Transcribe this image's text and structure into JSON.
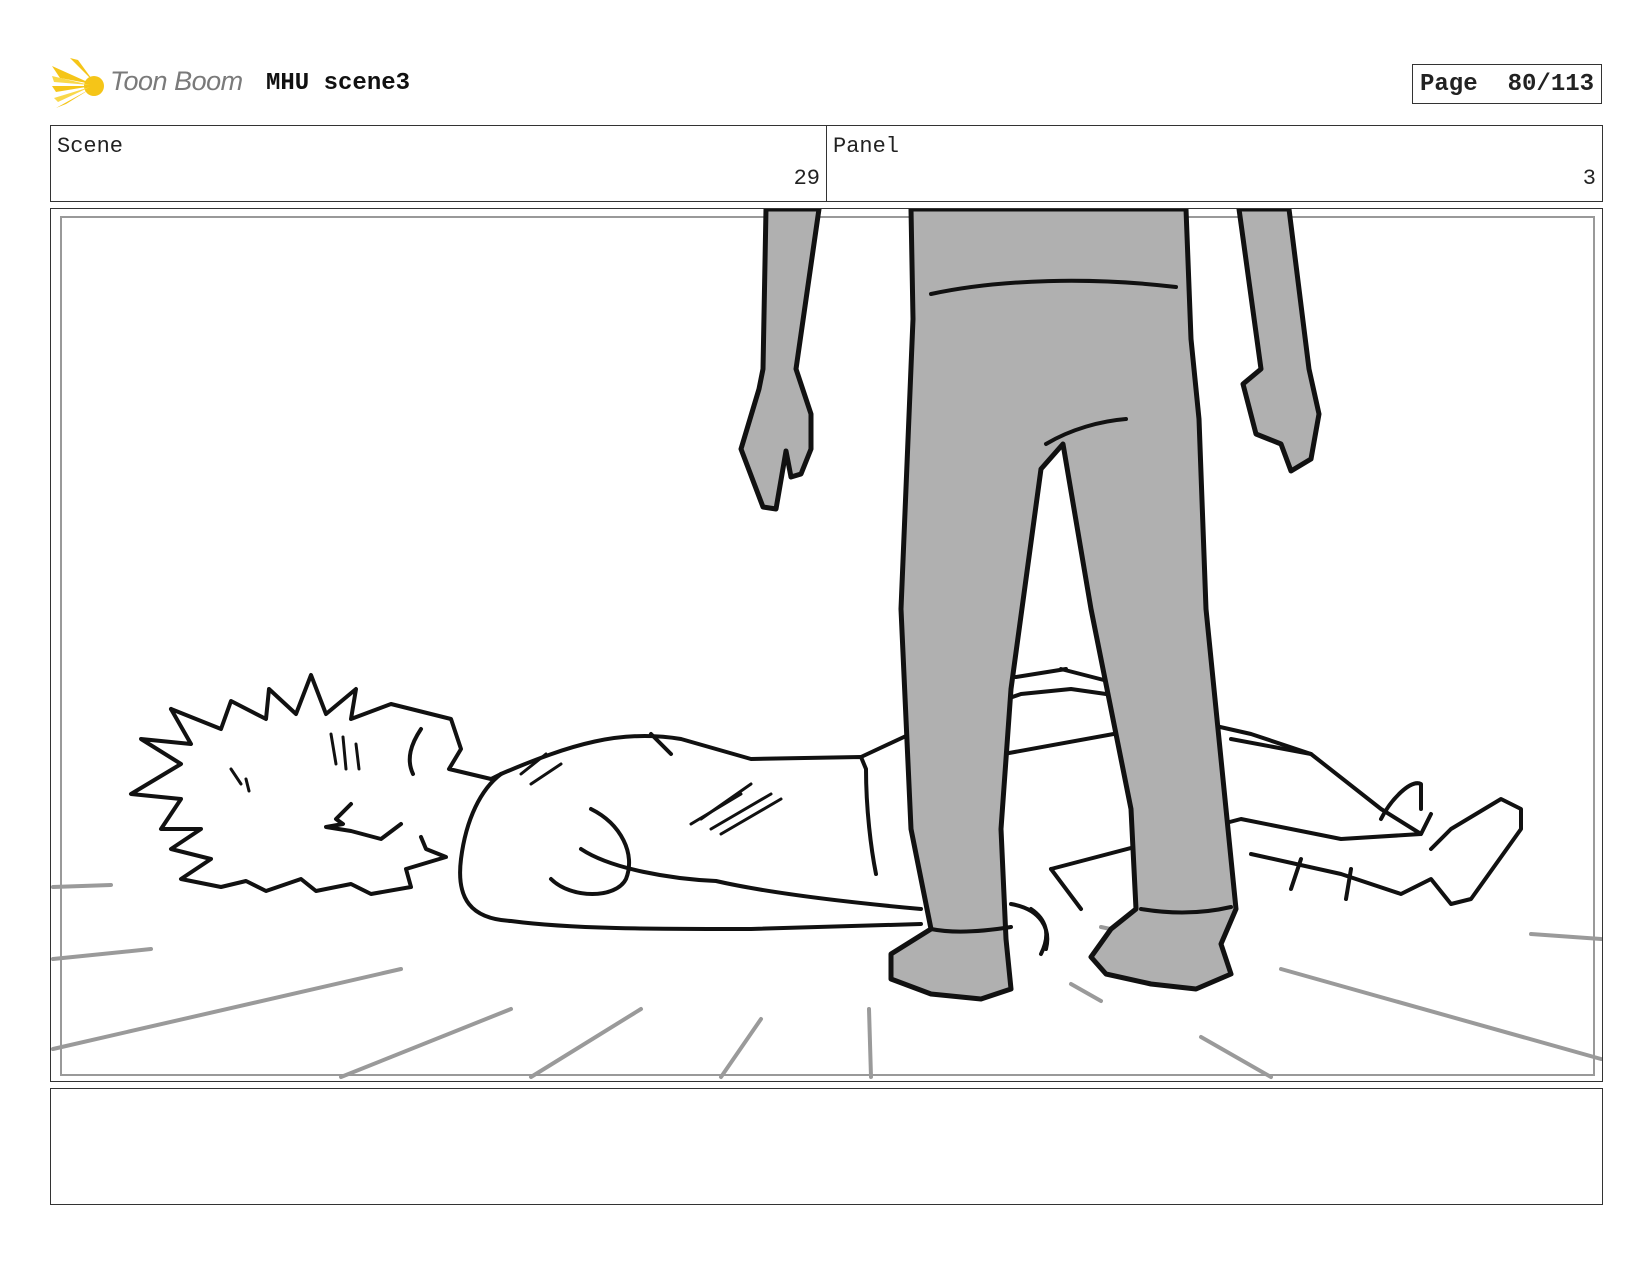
{
  "header": {
    "logo_text": "Toon Boom",
    "title": "MHU scene3",
    "page_label": "Page",
    "page_value": "80/113"
  },
  "info": {
    "scene_label": "Scene",
    "scene_value": "29",
    "panel_label": "Panel",
    "panel_value": "3"
  },
  "notes": {
    "text": ""
  },
  "icons": {
    "logo": "toon-boom-star-icon"
  },
  "colors": {
    "logo_yellow": "#f5c518",
    "shade_gray": "#b0b0b0",
    "line": "#111111"
  }
}
